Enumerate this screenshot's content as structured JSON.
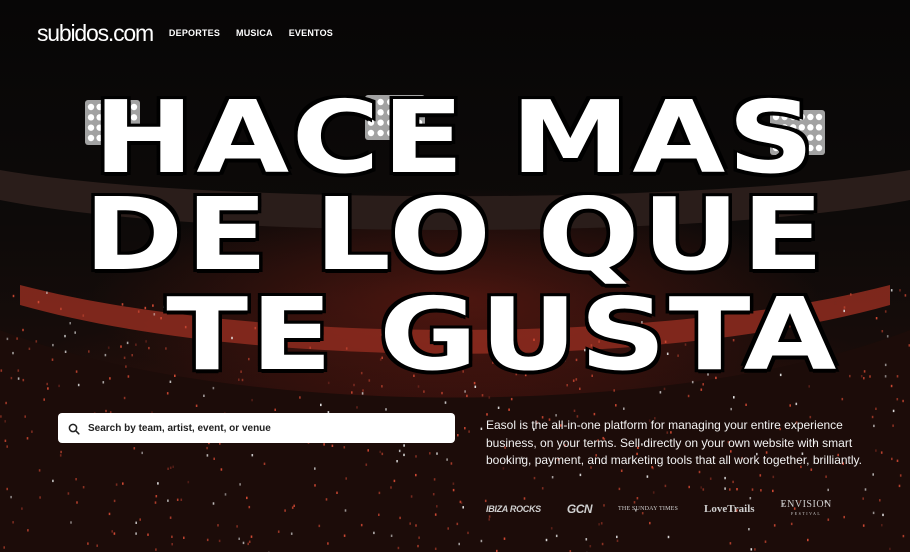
{
  "header": {
    "logo": "subidos.com",
    "nav": [
      "DEPORTES",
      "MUSICA",
      "EVENTOS"
    ]
  },
  "hero": {
    "headline": [
      "HACE MAS",
      "DE LO QUE",
      "TE GUSTA"
    ]
  },
  "search": {
    "placeholder": "Search by team, artist, event, or venue"
  },
  "tagline": "Easol is the all-in-one platform for managing your entire experience business, on your terms. Sell directly on your own website with smart booking, payment, and marketing tools that all work together, brilliantly.",
  "partners": {
    "ibiza": "IBIZA ROCKS",
    "gcn": "GCN",
    "times": "THE SUNDAY TIMES",
    "lovetrails": "LoveTrails",
    "envision": "ENVISION",
    "envision_sub": "FESTIVAL"
  },
  "colors": {
    "background": "#0a0808",
    "accent_crowd": "#c8402c",
    "text": "#ffffff"
  }
}
